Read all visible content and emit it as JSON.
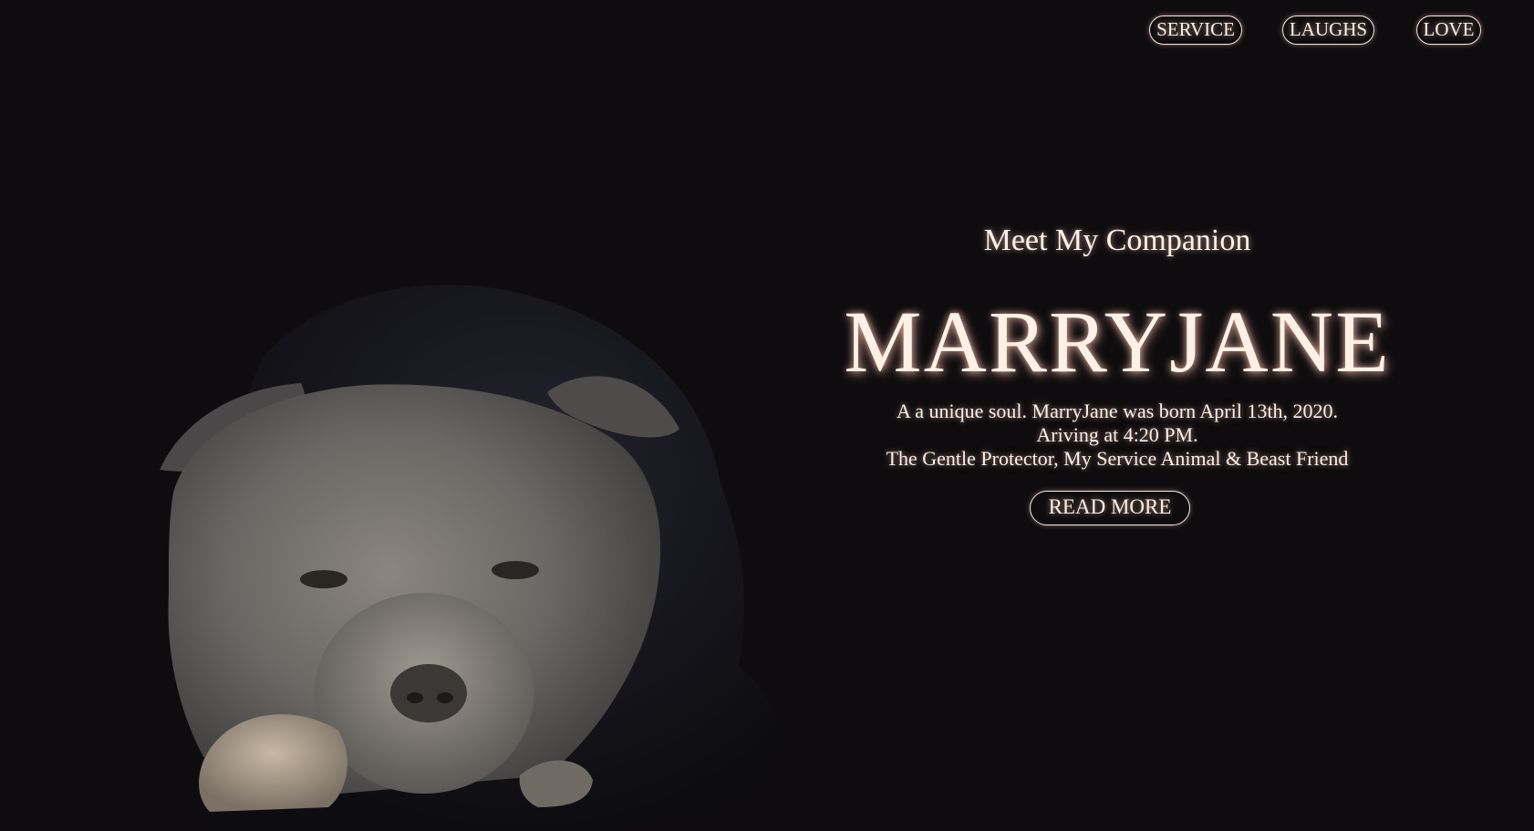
{
  "nav": {
    "items": [
      {
        "label": "SERVICE"
      },
      {
        "label": "LAUGHS"
      },
      {
        "label": "LOVE"
      }
    ]
  },
  "hero": {
    "subtitle": "Meet My Companion",
    "title": "MARRYJANE",
    "description_lines": [
      "A a unique soul. MarryJane was born April 13th, 2020.",
      "Ariving at 4:20 PM.",
      "The Gentle Protector, My Service Animal & Beast Friend"
    ],
    "cta_label": "READ MORE"
  },
  "colors": {
    "background": "#0e0c0e",
    "text": "#fdf0e6",
    "glow": "#ffd0c0",
    "dog_fur_dark": "#15151c",
    "dog_face_gray": "#6b6866"
  },
  "image": {
    "subject": "dark gray pit bull dog lying down, head resting on paws"
  }
}
